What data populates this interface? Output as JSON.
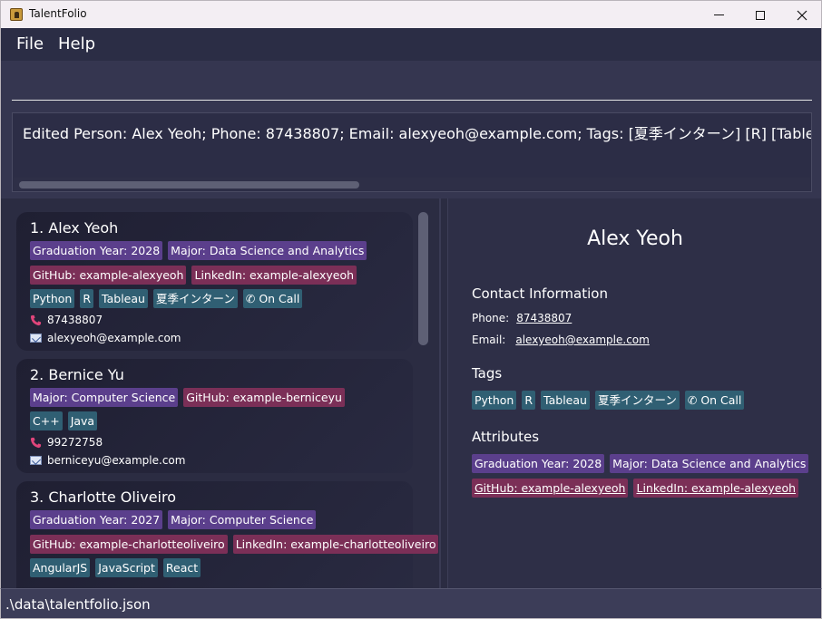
{
  "window": {
    "title": "TalentFolio",
    "minimize_icon": "minimize-icon",
    "maximize_icon": "maximize-icon",
    "close_icon": "close-icon"
  },
  "menu": {
    "file": "File",
    "help": "Help"
  },
  "command": {
    "value": ""
  },
  "result": {
    "text": "Edited Person: Alex Yeoh; Phone: 87438807; Email: alexyeoh@example.com; Tags: [夏季インターン] [R] [Tableau] ["
  },
  "persons": [
    {
      "name": "1. Alex Yeoh",
      "attr_rows": [
        [
          {
            "label": "Graduation Year: 2028",
            "color": "purple"
          },
          {
            "label": "Major: Data Science and Analytics",
            "color": "purple"
          }
        ],
        [
          {
            "label": "GitHub: example-alexyeoh",
            "color": "pink"
          },
          {
            "label": "LinkedIn: example-alexyeoh",
            "color": "pink"
          }
        ]
      ],
      "tags": [
        "Python",
        "R",
        "Tableau",
        "夏季インターン",
        "On Call"
      ],
      "phone": "87438807",
      "email": "alexyeoh@example.com"
    },
    {
      "name": "2. Bernice Yu",
      "attr_rows": [
        [
          {
            "label": "Major: Computer Science",
            "color": "purple"
          },
          {
            "label": "GitHub: example-berniceyu",
            "color": "pink"
          }
        ]
      ],
      "tags": [
        "C++",
        "Java"
      ],
      "phone": "99272758",
      "email": "berniceyu@example.com"
    },
    {
      "name": "3. Charlotte Oliveiro",
      "attr_rows": [
        [
          {
            "label": "Graduation Year: 2027",
            "color": "purple"
          },
          {
            "label": "Major: Computer Science",
            "color": "purple"
          }
        ],
        [
          {
            "label": "GitHub: example-charlotteoliveiro",
            "color": "pink"
          },
          {
            "label": "LinkedIn: example-charlotteoliveiro",
            "color": "pink"
          }
        ]
      ],
      "tags": [
        "AngularJS",
        "JavaScript",
        "React"
      ]
    }
  ],
  "detail": {
    "name": "Alex Yeoh",
    "contact_title": "Contact Information",
    "phone_label": "Phone:",
    "phone": "87438807",
    "email_label": "Email:",
    "email": "alexyeoh@example.com",
    "tags_title": "Tags",
    "tags": [
      "Python",
      "R",
      "Tableau",
      "夏季インターン",
      "On Call"
    ],
    "attributes_title": "Attributes",
    "attributes": [
      {
        "label": "Graduation Year: 2028",
        "color": "purple"
      },
      {
        "label": "Major: Data Science and Analytics",
        "color": "purple"
      },
      {
        "label": "GitHub: example-alexyeoh",
        "color": "pink"
      },
      {
        "label": "LinkedIn: example-alexyeoh",
        "color": "pink"
      }
    ]
  },
  "status": {
    "path": ".\\data\\talentfolio.json"
  },
  "colors": {
    "purple": "#5b3f8c",
    "pink": "#7b2f57",
    "teal": "#305f73",
    "background": "#2a2b3f"
  }
}
